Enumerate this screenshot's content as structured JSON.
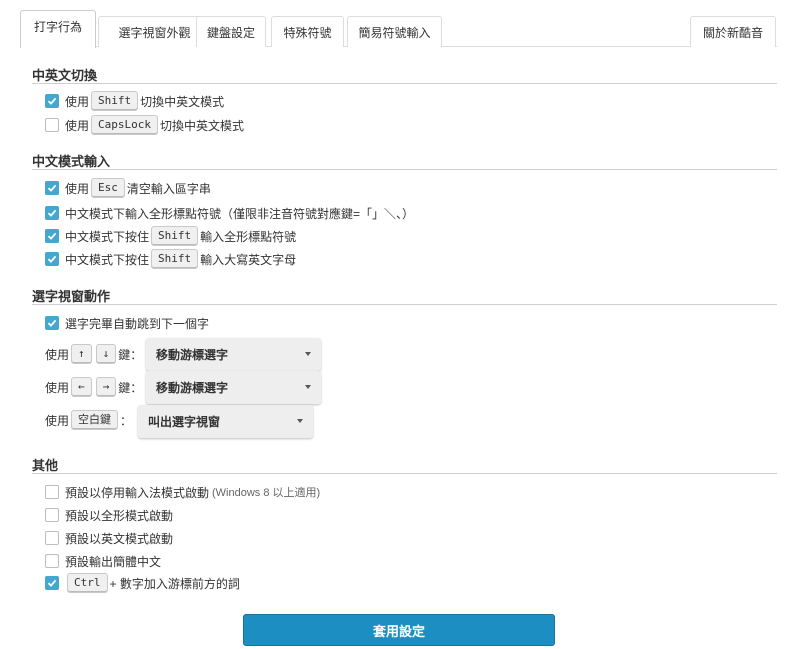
{
  "tabs": [
    {
      "label": "打字行為",
      "active": true
    },
    {
      "label": "選字視窗外觀"
    },
    {
      "label": "鍵盤設定"
    },
    {
      "label": "特殊符號"
    },
    {
      "label": "簡易符號輸入"
    },
    {
      "label": "關於新酷音"
    }
  ],
  "sections": {
    "switch": {
      "title": "中英文切換",
      "items": [
        {
          "checked": true,
          "pre": "使用",
          "key": "Shift",
          "post": "切換中英文模式"
        },
        {
          "checked": false,
          "pre": "使用",
          "key": "CapsLock",
          "post": "切換中英文模式"
        }
      ]
    },
    "chinese": {
      "title": "中文模式輸入",
      "items": [
        {
          "checked": true,
          "pre": "使用",
          "key": "Esc",
          "post": "清空輸入區字串"
        },
        {
          "checked": true,
          "text": "中文模式下輸入全形標點符號（僅限非注音符號對應鍵=「」＼、）"
        },
        {
          "checked": true,
          "pre": "中文模式下按住",
          "key": "Shift",
          "post": "輸入全形標點符號"
        },
        {
          "checked": true,
          "pre": "中文模式下按住",
          "key": "Shift",
          "post": "輸入大寫英文字母"
        }
      ]
    },
    "candidate": {
      "title": "選字視窗動作",
      "auto_next": {
        "checked": true,
        "text": "選字完畢自動跳到下一個字"
      },
      "rows": [
        {
          "pre": "使用",
          "keys": [
            "↑",
            "↓"
          ],
          "post": "鍵：",
          "selected": "移動游標選字"
        },
        {
          "pre": "使用",
          "keys": [
            "←",
            "→"
          ],
          "post": "鍵：",
          "selected": "移動游標選字"
        },
        {
          "pre": "使用",
          "keys": [
            "空白鍵"
          ],
          "post": "：",
          "selected": "叫出選字視窗"
        }
      ]
    },
    "other": {
      "title": "其他",
      "items": [
        {
          "checked": false,
          "text": "預設以停用輸入法模式啟動",
          "note": "(Windows 8 以上適用)"
        },
        {
          "checked": false,
          "text": "預設以全形模式啟動"
        },
        {
          "checked": false,
          "text": "預設以英文模式啟動"
        },
        {
          "checked": false,
          "text": "預設輸出簡體中文"
        },
        {
          "checked": true,
          "key": "Ctrl",
          "post": " + 數字加入游標前方的詞"
        }
      ]
    }
  },
  "apply_label": "套用設定",
  "colors": {
    "accent": "#1d8ec2",
    "check": "#43a7cf"
  }
}
